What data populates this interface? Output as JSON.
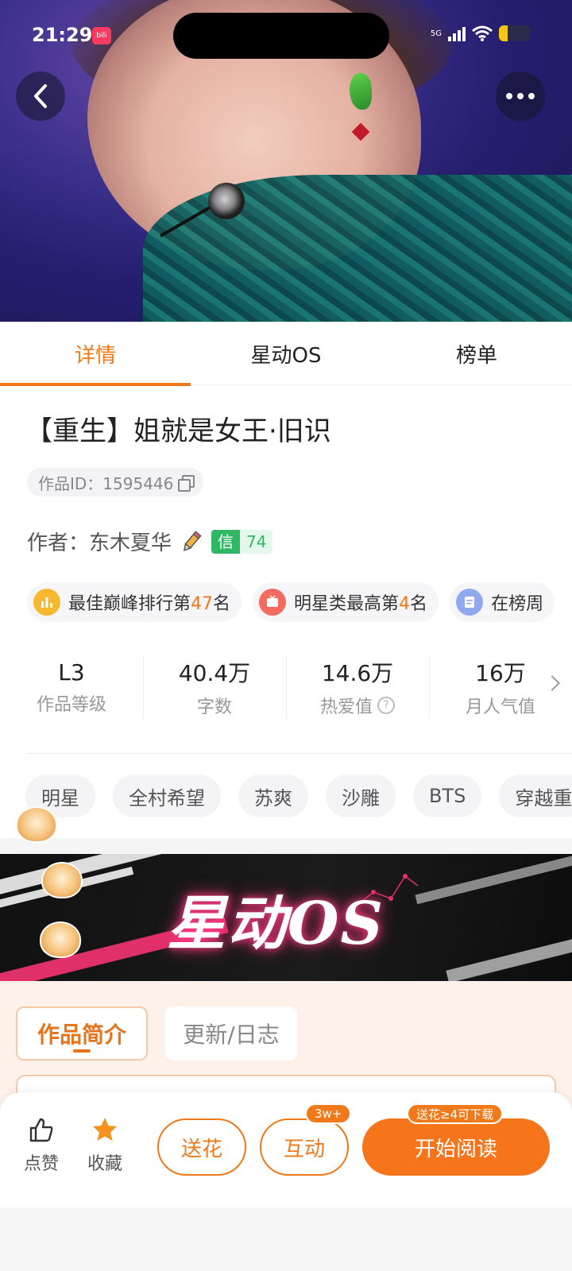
{
  "status": {
    "time": "21:29",
    "app_badge": "bili",
    "network": "5G"
  },
  "hero": {
    "back_icon": "chevron-left-icon",
    "more_icon": "more-dots-icon"
  },
  "tabs": [
    {
      "label": "详情",
      "active": true
    },
    {
      "label": "星动OS",
      "active": false
    },
    {
      "label": "榜单",
      "active": false
    }
  ],
  "work": {
    "title": "【重生】姐就是女王·旧识",
    "id_label": "作品ID：1595446",
    "author_label": "作者：东木夏华",
    "credit_key": "信",
    "credit_value": "74"
  },
  "ranks": [
    {
      "pre": "最佳巅峰排行第",
      "num": "47",
      "post": "名",
      "color": "#f5b82e"
    },
    {
      "pre": "明星类最高第",
      "num": "4",
      "post": "名",
      "color": "#f36b5f"
    },
    {
      "pre": "在榜周",
      "num": "",
      "post": "",
      "color": "#8fa8f0"
    }
  ],
  "stats": [
    {
      "value": "L3",
      "label": "作品等级"
    },
    {
      "value": "40.4万",
      "label": "字数"
    },
    {
      "value": "14.6万",
      "label": "热爱值"
    },
    {
      "value": "16万",
      "label": "月人气值"
    }
  ],
  "tags": [
    "明星",
    "全村希望",
    "苏爽",
    "沙雕",
    "BTS",
    "穿越重"
  ],
  "banner": {
    "title": "星动OS"
  },
  "intro_tabs": {
    "active": "作品简介",
    "other": "更新/日志"
  },
  "bottom": {
    "like": "点赞",
    "favorite": "收藏",
    "flower": "送花",
    "interact": "互动",
    "interact_badge": "3w+",
    "read": "开始阅读",
    "read_badge": "送花≥4可下载"
  },
  "colors": {
    "accent": "#f07a1a",
    "credit": "#2fb864"
  }
}
